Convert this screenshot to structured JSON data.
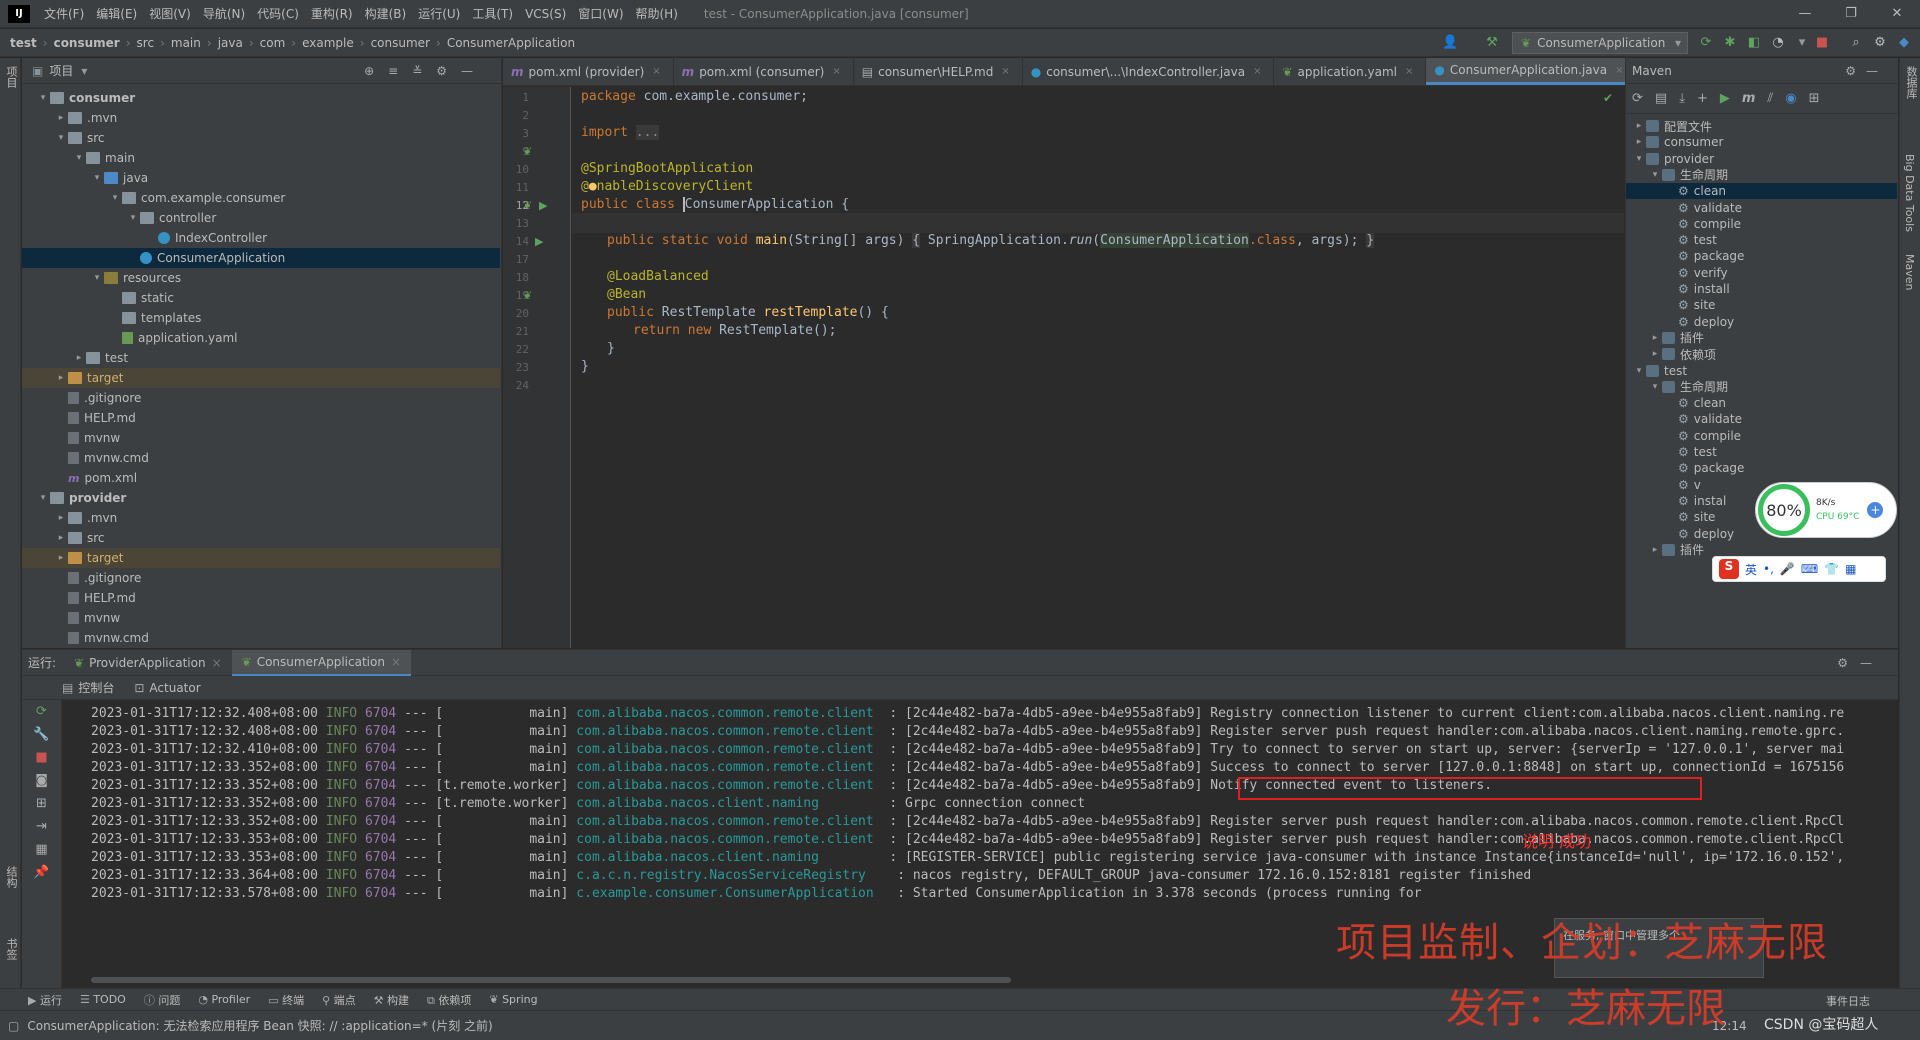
{
  "menubar": {
    "logo": "IJ",
    "items": [
      "文件(F)",
      "编辑(E)",
      "视图(V)",
      "导航(N)",
      "代码(C)",
      "重构(R)",
      "构建(B)",
      "运行(U)",
      "工具(T)",
      "VCS(S)",
      "窗口(W)",
      "帮助(H)"
    ],
    "window_title": "test - ConsumerApplication.java [consumer]",
    "controls": [
      "—",
      "❐",
      "✕"
    ]
  },
  "breadcrumb": [
    "test",
    "consumer",
    "src",
    "main",
    "java",
    "com",
    "example",
    "consumer",
    "ConsumerApplication"
  ],
  "run_config": "ConsumerApplication",
  "project_panel": {
    "title": "项目",
    "tree": [
      {
        "label": "consumer",
        "depth": 0,
        "arrow": "open",
        "icon": "folder",
        "bold": true
      },
      {
        "label": ".mvn",
        "depth": 1,
        "arrow": "closed",
        "icon": "folder"
      },
      {
        "label": "src",
        "depth": 1,
        "arrow": "open",
        "icon": "folder"
      },
      {
        "label": "main",
        "depth": 2,
        "arrow": "open",
        "icon": "folder"
      },
      {
        "label": "java",
        "depth": 3,
        "arrow": "open",
        "icon": "srcf"
      },
      {
        "label": "com.example.consumer",
        "depth": 4,
        "arrow": "open",
        "icon": "pkg"
      },
      {
        "label": "controller",
        "depth": 5,
        "arrow": "open",
        "icon": "pkg"
      },
      {
        "label": "IndexController",
        "depth": 6,
        "arrow": "none",
        "icon": "cls"
      },
      {
        "label": "ConsumerApplication",
        "depth": 5,
        "arrow": "none",
        "icon": "cls",
        "selected": true
      },
      {
        "label": "resources",
        "depth": 3,
        "arrow": "open",
        "icon": "resf"
      },
      {
        "label": "static",
        "depth": 4,
        "arrow": "none",
        "icon": "folder"
      },
      {
        "label": "templates",
        "depth": 4,
        "arrow": "none",
        "icon": "folder"
      },
      {
        "label": "application.yaml",
        "depth": 4,
        "arrow": "none",
        "icon": "yaml"
      },
      {
        "label": "test",
        "depth": 2,
        "arrow": "closed",
        "icon": "folder"
      },
      {
        "label": "target",
        "depth": 1,
        "arrow": "closed",
        "icon": "tgtf",
        "target": true
      },
      {
        "label": ".gitignore",
        "depth": 1,
        "arrow": "none",
        "icon": "file"
      },
      {
        "label": "HELP.md",
        "depth": 1,
        "arrow": "none",
        "icon": "file"
      },
      {
        "label": "mvnw",
        "depth": 1,
        "arrow": "none",
        "icon": "file"
      },
      {
        "label": "mvnw.cmd",
        "depth": 1,
        "arrow": "none",
        "icon": "file"
      },
      {
        "label": "pom.xml",
        "depth": 1,
        "arrow": "none",
        "icon": "mvn"
      },
      {
        "label": "provider",
        "depth": 0,
        "arrow": "open",
        "icon": "folder",
        "bold": true
      },
      {
        "label": ".mvn",
        "depth": 1,
        "arrow": "closed",
        "icon": "folder"
      },
      {
        "label": "src",
        "depth": 1,
        "arrow": "closed",
        "icon": "folder"
      },
      {
        "label": "target",
        "depth": 1,
        "arrow": "closed",
        "icon": "tgtf",
        "target": true
      },
      {
        "label": ".gitignore",
        "depth": 1,
        "arrow": "none",
        "icon": "file"
      },
      {
        "label": "HELP.md",
        "depth": 1,
        "arrow": "none",
        "icon": "file"
      },
      {
        "label": "mvnw",
        "depth": 1,
        "arrow": "none",
        "icon": "file"
      },
      {
        "label": "mvnw.cmd",
        "depth": 1,
        "arrow": "none",
        "icon": "file"
      }
    ]
  },
  "editor_tabs": [
    {
      "label": "pom.xml (provider)",
      "icon": "m"
    },
    {
      "label": "pom.xml (consumer)",
      "icon": "m"
    },
    {
      "label": "consumer\\HELP.md",
      "icon": "md"
    },
    {
      "label": "consumer\\...\\IndexController.java",
      "icon": "c"
    },
    {
      "label": "application.yaml",
      "icon": "y"
    },
    {
      "label": "ConsumerApplication.java",
      "icon": "c",
      "active": true
    }
  ],
  "code": {
    "line_numbers": [
      "1",
      "2",
      "3",
      "9",
      "10",
      "11",
      "12",
      "13",
      "14",
      "17",
      "18",
      "19",
      "20",
      "21",
      "22",
      "23",
      "24"
    ],
    "l1_kw": "package ",
    "l1_rest": "com.example.consumer;",
    "l3_kw": "import ",
    "l3_fold": "...",
    "l10": "@SpringBootApplication",
    "l11_at": "@",
    "l11_rest": "nableDiscoveryClient",
    "l12_kw": "public class ",
    "l12_cls": "ConsumerApplication",
    "l12_rest": " {",
    "l14_kw": "public static void ",
    "l14_fn": "main",
    "l14_args": "(String[] args) ",
    "l14_b1": "{",
    "l14_body": " SpringApplication.",
    "l14_run": "run",
    "l14_p": "(",
    "l14_cls": "ConsumerApplication",
    "l14_kw2": ".class",
    "l14_end": ", args); ",
    "l14_b2": "}",
    "l18": "@LoadBalanced",
    "l19": "@Bean",
    "l20_kw": "public ",
    "l20_type": "RestTemplate ",
    "l20_fn": "restTemplate",
    "l20_rest": "() {",
    "l21_kw": "return new ",
    "l21_rest": "RestTemplate();",
    "l22": "}",
    "l23": "}"
  },
  "maven": {
    "title": "Maven",
    "tree": [
      {
        "label": "配置文件",
        "depth": 0,
        "arrow": "closed",
        "icon": "pic"
      },
      {
        "label": "consumer",
        "depth": 0,
        "arrow": "closed",
        "icon": "pic"
      },
      {
        "label": "provider",
        "depth": 0,
        "arrow": "open",
        "icon": "pic"
      },
      {
        "label": "生命周期",
        "depth": 1,
        "arrow": "open",
        "icon": "pic"
      },
      {
        "label": "clean",
        "depth": 2,
        "icon": "gear",
        "selected": true
      },
      {
        "label": "validate",
        "depth": 2,
        "icon": "gear"
      },
      {
        "label": "compile",
        "depth": 2,
        "icon": "gear"
      },
      {
        "label": "test",
        "depth": 2,
        "icon": "gear"
      },
      {
        "label": "package",
        "depth": 2,
        "icon": "gear"
      },
      {
        "label": "verify",
        "depth": 2,
        "icon": "gear"
      },
      {
        "label": "install",
        "depth": 2,
        "icon": "gear"
      },
      {
        "label": "site",
        "depth": 2,
        "icon": "gear"
      },
      {
        "label": "deploy",
        "depth": 2,
        "icon": "gear"
      },
      {
        "label": "插件",
        "depth": 1,
        "arrow": "closed",
        "icon": "pic"
      },
      {
        "label": "依赖项",
        "depth": 1,
        "arrow": "closed",
        "icon": "pic"
      },
      {
        "label": "test",
        "depth": 0,
        "arrow": "open",
        "icon": "pic"
      },
      {
        "label": "生命周期",
        "depth": 1,
        "arrow": "open",
        "icon": "pic"
      },
      {
        "label": "clean",
        "depth": 2,
        "icon": "gear"
      },
      {
        "label": "validate",
        "depth": 2,
        "icon": "gear"
      },
      {
        "label": "compile",
        "depth": 2,
        "icon": "gear"
      },
      {
        "label": "test",
        "depth": 2,
        "icon": "gear"
      },
      {
        "label": "package",
        "depth": 2,
        "icon": "gear"
      },
      {
        "label": "v",
        "depth": 2,
        "icon": "gear"
      },
      {
        "label": "instal",
        "depth": 2,
        "icon": "gear"
      },
      {
        "label": "site",
        "depth": 2,
        "icon": "gear"
      },
      {
        "label": "deploy",
        "depth": 2,
        "icon": "gear"
      },
      {
        "label": "插件",
        "depth": 1,
        "arrow": "closed",
        "icon": "pic"
      }
    ]
  },
  "run": {
    "label": "运行:",
    "tabs": [
      "ProviderApplication",
      "ConsumerApplication"
    ],
    "subtabs": [
      "控制台",
      "Actuator"
    ],
    "logs": [
      {
        "ts": "2023-01-31T17:12:32.408+08:00",
        "lv": "INFO",
        "pid": "6704",
        "th": "--- [           main]",
        "lgr": "com.alibaba.nacos.common.remote.client",
        "msg": "  : [2c44e482-ba7a-4db5-a9ee-b4e955a8fab9] Registry connection listener to current client:com.alibaba.nacos.client.naming.re"
      },
      {
        "ts": "2023-01-31T17:12:32.408+08:00",
        "lv": "INFO",
        "pid": "6704",
        "th": "--- [           main]",
        "lgr": "com.alibaba.nacos.common.remote.client",
        "msg": "  : [2c44e482-ba7a-4db5-a9ee-b4e955a8fab9] Register server push request handler:com.alibaba.nacos.client.naming.remote.gprc."
      },
      {
        "ts": "2023-01-31T17:12:32.410+08:00",
        "lv": "INFO",
        "pid": "6704",
        "th": "--- [           main]",
        "lgr": "com.alibaba.nacos.common.remote.client",
        "msg": "  : [2c44e482-ba7a-4db5-a9ee-b4e955a8fab9] Try to connect to server on start up, server: {serverIp = '127.0.0.1', server mai"
      },
      {
        "ts": "2023-01-31T17:12:33.352+08:00",
        "lv": "INFO",
        "pid": "6704",
        "th": "--- [           main]",
        "lgr": "com.alibaba.nacos.common.remote.client",
        "msg": "  : [2c44e482-ba7a-4db5-a9ee-b4e955a8fab9] Success to connect to server [127.0.0.1:8848] on start up, connectionId = 1675156"
      },
      {
        "ts": "2023-01-31T17:12:33.352+08:00",
        "lv": "INFO",
        "pid": "6704",
        "th": "--- [t.remote.worker]",
        "lgr": "com.alibaba.nacos.common.remote.client",
        "msg": "  : [2c44e482-ba7a-4db5-a9ee-b4e955a8fab9] Notify connected event to listeners."
      },
      {
        "ts": "2023-01-31T17:12:33.352+08:00",
        "lv": "INFO",
        "pid": "6704",
        "th": "--- [t.remote.worker]",
        "lgr": "com.alibaba.nacos.client.naming       ",
        "msg": "  : Grpc connection connect"
      },
      {
        "ts": "2023-01-31T17:12:33.352+08:00",
        "lv": "INFO",
        "pid": "6704",
        "th": "--- [           main]",
        "lgr": "com.alibaba.nacos.common.remote.client",
        "msg": "  : [2c44e482-ba7a-4db5-a9ee-b4e955a8fab9] Register server push request handler:com.alibaba.nacos.common.remote.client.RpcCl"
      },
      {
        "ts": "2023-01-31T17:12:33.353+08:00",
        "lv": "INFO",
        "pid": "6704",
        "th": "--- [           main]",
        "lgr": "com.alibaba.nacos.common.remote.client",
        "msg": "  : [2c44e482-ba7a-4db5-a9ee-b4e955a8fab9] Register server push request handler:com.alibaba.nacos.common.remote.client.RpcCl"
      },
      {
        "ts": "2023-01-31T17:12:33.353+08:00",
        "lv": "INFO",
        "pid": "6704",
        "th": "--- [           main]",
        "lgr": "com.alibaba.nacos.client.naming       ",
        "msg": "  : [REGISTER-SERVICE] public registering service java-consumer with instance Instance{instanceId='null', ip='172.16.0.152',"
      },
      {
        "ts": "2023-01-31T17:12:33.364+08:00",
        "lv": "INFO",
        "pid": "6704",
        "th": "--- [           main]",
        "lgr": "c.a.c.n.registry.NacosServiceRegistry  ",
        "msg": "  : nacos registry, DEFAULT_GROUP java-consumer 172.16.0.152:8181 register finished"
      },
      {
        "ts": "2023-01-31T17:12:33.578+08:00",
        "lv": "INFO",
        "pid": "6704",
        "th": "--- [           main]",
        "lgr": "c.example.consumer.ConsumerApplication ",
        "msg": "  : Started ConsumerApplication in 3.378 seconds (process running for"
      }
    ]
  },
  "annotation_note": "说明 成功",
  "status_tabs": [
    "运行",
    "TODO",
    "问题",
    "Profiler",
    "终端",
    "端点",
    "构建",
    "依赖项",
    "Spring"
  ],
  "event_log": "事件日志",
  "status_message": "ConsumerApplication: 无法检索应用程序 Bean 快照: // :application=* (片刻 之前)",
  "widget": {
    "percent": "80%",
    "speed": "8K/s",
    "cpu": "CPU 69°C"
  },
  "ime": {
    "logo": "S",
    "lang": "英"
  },
  "toast_text": "在服务, 窗口中管理多个...",
  "watermark_line1": "项目监制、企划：芝麻无限",
  "watermark_line2": "发行：芝麻无限",
  "csdn": "CSDN @宝码超人",
  "clock": "12:14",
  "left_strip_labels": [
    "项目",
    "结构",
    "书签"
  ],
  "right_strip_labels": [
    "数据库",
    "Big Data Tools",
    "Maven"
  ]
}
